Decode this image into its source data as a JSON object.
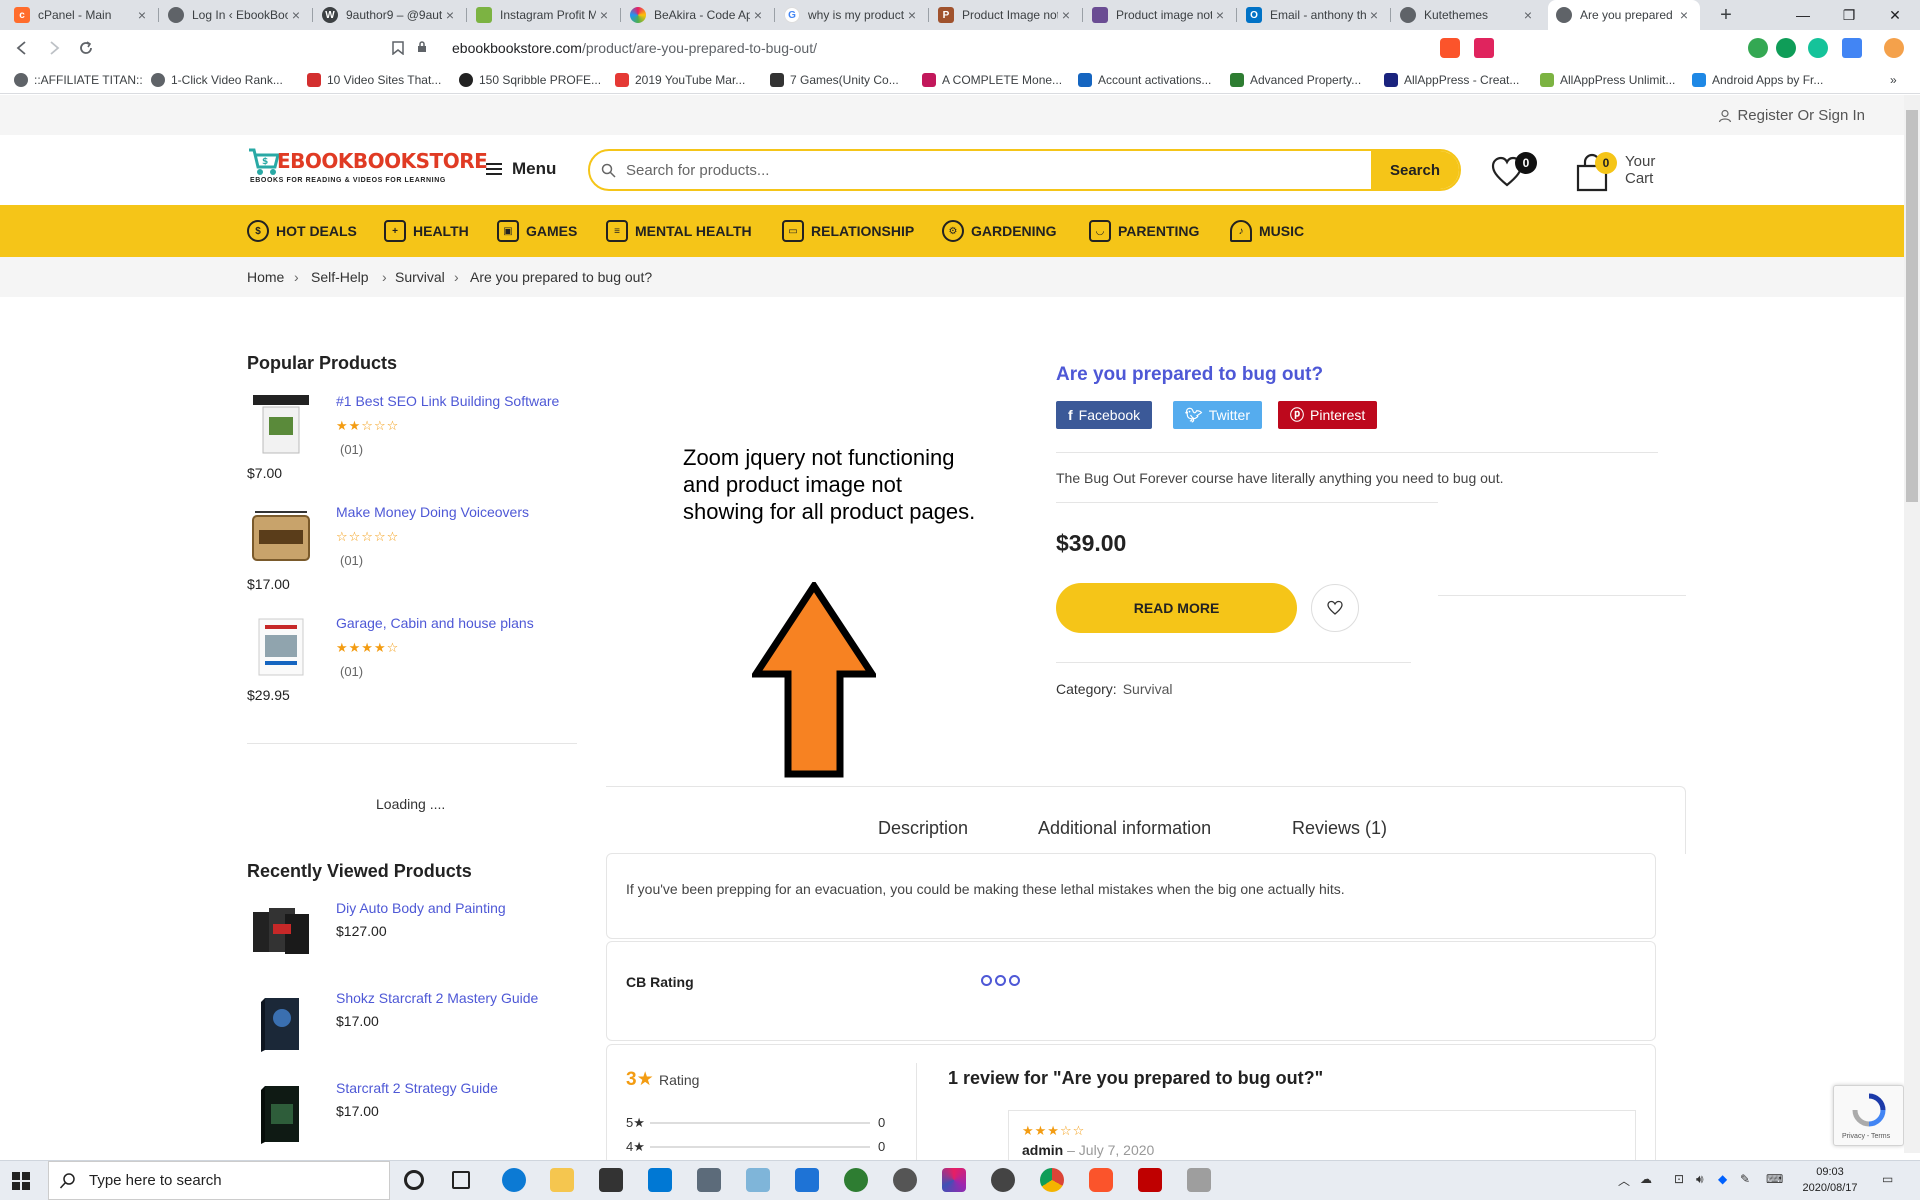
{
  "browser": {
    "tabs": [
      {
        "title": "cPanel - Main",
        "color": "#ff6c2c",
        "icon": "cpanel-icon"
      },
      {
        "title": "Log In ‹ EbookBook",
        "color": "#5f6368",
        "icon": "globe-icon"
      },
      {
        "title": "9author9 – @9auth",
        "color": "#3c4043",
        "icon": "wordpress-icon"
      },
      {
        "title": "Instagram Profit M",
        "color": "#7cb342",
        "icon": "instagram-icon"
      },
      {
        "title": "BeAkira - Code Ap",
        "color": "#e91e63",
        "icon": "beakira-icon"
      },
      {
        "title": "why is my product",
        "color": "#4285f4",
        "icon": "google-icon"
      },
      {
        "title": "Product Image not",
        "color": "#a0522d",
        "icon": "p-icon"
      },
      {
        "title": "Product image not",
        "color": "#6a4c93",
        "icon": "forum-icon"
      },
      {
        "title": "Email - anthony th",
        "color": "#0072c6",
        "icon": "outlook-icon"
      },
      {
        "title": "Kutethemes",
        "color": "#5f6368",
        "icon": "globe-icon"
      },
      {
        "title": "Are you prepared",
        "color": "#5f6368",
        "icon": "globe-icon",
        "active": true
      }
    ],
    "url_domain": "ebookbookstore.com",
    "url_path": "/product/are-you-prepared-to-bug-out/",
    "bookmarks": [
      {
        "label": "::AFFILIATE TITAN::",
        "color": "#5f6368"
      },
      {
        "label": "1-Click Video Rank...",
        "color": "#5f6368"
      },
      {
        "label": "10 Video Sites That...",
        "color": "#d32f2f"
      },
      {
        "label": "150 Sqribble PROFE...",
        "color": "#222222"
      },
      {
        "label": "2019 YouTube Mar...",
        "color": "#e53935"
      },
      {
        "label": "7 Games(Unity Co...",
        "color": "#333333"
      },
      {
        "label": "A COMPLETE Mone...",
        "color": "#c2185b"
      },
      {
        "label": "Account activations...",
        "color": "#1565c0"
      },
      {
        "label": "Advanced Property...",
        "color": "#2e7d32"
      },
      {
        "label": "AllAppPress - Creat...",
        "color": "#1a237e"
      },
      {
        "label": "AllAppPress Unlimit...",
        "color": "#7cb342"
      },
      {
        "label": "Android Apps by Fr...",
        "color": "#1e88e5"
      }
    ]
  },
  "site": {
    "signin": "Register Or Sign In",
    "logo_text": "EBOOKBOOKSTORE",
    "logo_sub": "EBOOKS FOR READING & VIDEOS FOR LEARNING",
    "menu_label": "Menu",
    "search_placeholder": "Search for products...",
    "search_button": "Search",
    "wishlist_count": "0",
    "cart_count": "0",
    "cart_label": "Your Cart",
    "accent_color": "#f5c518",
    "categories": [
      "Hot Deals",
      "Health",
      "Games",
      "Mental Health",
      "Relationship",
      "Gardening",
      "Parenting",
      "Music"
    ]
  },
  "breadcrumb": [
    "Home",
    "Self-Help",
    "Survival",
    "Are you prepared to bug out?"
  ],
  "sidebar": {
    "popular_heading": "Popular Products",
    "popular": [
      {
        "name": "#1 Best SEO Link Building Software",
        "stars": "★★☆☆☆",
        "count": "(01)",
        "price": "$7.00"
      },
      {
        "name": "Make Money Doing Voiceovers",
        "stars": "☆☆☆☆☆",
        "count": "(01)",
        "price": "$17.00"
      },
      {
        "name": "Garage, Cabin and house plans",
        "stars": "★★★★☆",
        "count": "(01)",
        "price": "$29.95"
      }
    ],
    "loading": "Loading ....",
    "recent_heading": "Recently Viewed Products",
    "recent": [
      {
        "name": "Diy Auto Body and Painting",
        "price": "$127.00"
      },
      {
        "name": "Shokz Starcraft 2 Mastery Guide",
        "price": "$17.00"
      },
      {
        "name": "Starcraft 2 Strategy Guide",
        "price": "$17.00"
      }
    ]
  },
  "annotation": {
    "text": "Zoom jquery not functioning and product image not showing for all product pages."
  },
  "product": {
    "title": "Are you prepared to bug out?",
    "share": [
      {
        "label": "Facebook",
        "icon": "f",
        "color": "#3b5998"
      },
      {
        "label": "Twitter",
        "icon": "t",
        "color": "#55acee"
      },
      {
        "label": "Pinterest",
        "icon": "p",
        "color": "#bd081c"
      }
    ],
    "short_desc": "The Bug Out Forever course have literally anything you need to bug out.",
    "price": "$39.00",
    "read_more": "READ MORE",
    "category_label": "Category:",
    "category_value": "Survival"
  },
  "tabs": {
    "items": [
      "Description",
      "Additional information",
      "Reviews (1)"
    ],
    "description": "If you've been prepping for an evacuation, you could be making these lethal mistakes when the big one actually hits.",
    "cb_rating_label": "CB Rating"
  },
  "reviews": {
    "average": "3★",
    "average_word": "Rating",
    "bars": [
      {
        "label": "5★",
        "count": "0"
      },
      {
        "label": "4★",
        "count": "0"
      }
    ],
    "heading": "1 review for \"Are you prepared to bug out?\"",
    "item": {
      "stars": "★★★☆☆",
      "author": "admin",
      "date": "– July 7, 2020"
    }
  },
  "recaptcha": {
    "text": "Privacy - Terms"
  },
  "taskbar": {
    "search_placeholder": "Type here to search",
    "time": "09:03",
    "date": "2020/08/17"
  }
}
